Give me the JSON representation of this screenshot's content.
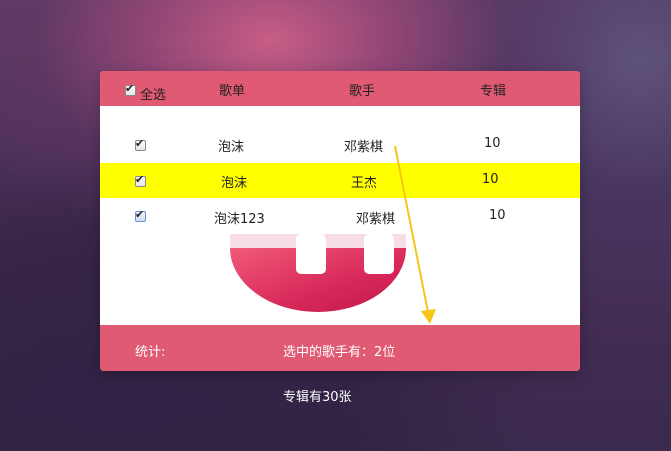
{
  "header": {
    "select_all_label": "全选",
    "select_all_checked": true,
    "col_playlist": "歌单",
    "col_singer": "歌手",
    "col_album": "专辑"
  },
  "rows": [
    {
      "checked": true,
      "playlist": "泡沫",
      "singer": "邓紫棋",
      "album": "10",
      "highlighted": false
    },
    {
      "checked": true,
      "playlist": "泡沫",
      "singer": "王杰",
      "album": "10",
      "highlighted": true
    },
    {
      "checked": true,
      "playlist": "泡沫123",
      "singer": "邓紫棋",
      "album": "10",
      "highlighted": false
    }
  ],
  "footer": {
    "stats_label": "统计:",
    "selected_singers": "选中的歌手有：2位"
  },
  "below_note": "专辑有30张",
  "colors": {
    "accent": "#e05a74",
    "highlight": "#ffff00",
    "arrow": "#f5c518"
  }
}
